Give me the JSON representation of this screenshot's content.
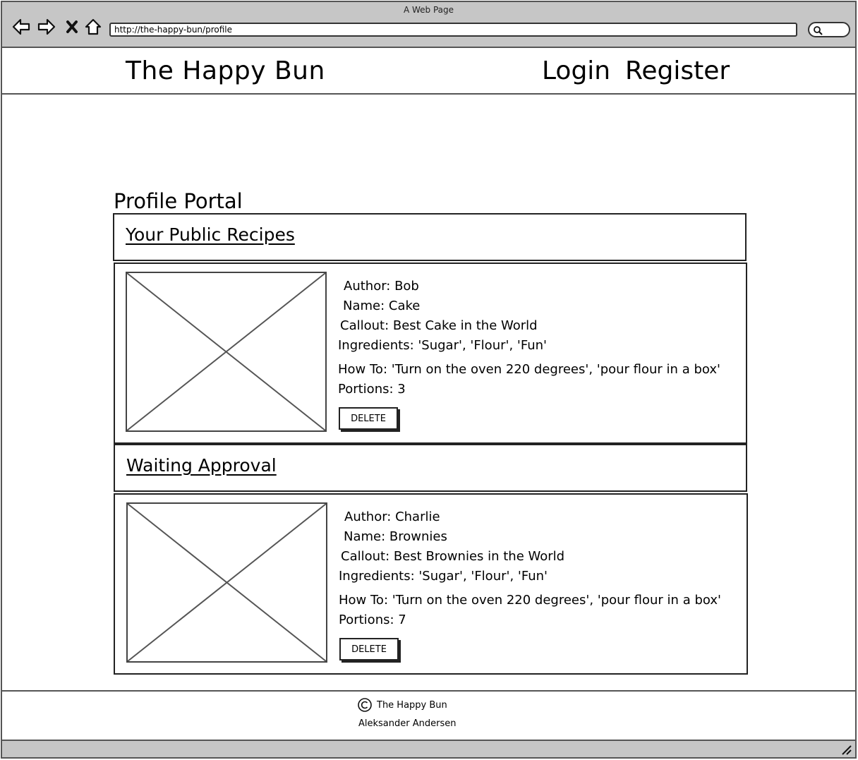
{
  "window": {
    "title": "A Web Page"
  },
  "browser": {
    "url": "http://the-happy-bun/profile",
    "icons": [
      "back-arrow-icon",
      "forward-arrow-icon",
      "close-x-icon",
      "home-icon",
      "search-icon"
    ]
  },
  "header": {
    "brand": "The Happy Bun",
    "nav": {
      "login": "Login",
      "register": "Register"
    }
  },
  "page_title": "Profile Portal",
  "sections": {
    "public": {
      "title": "Your Public Recipes",
      "recipe": {
        "author": "Author: Bob",
        "name": "Name: Cake",
        "callout": "Callout: Best Cake in the World",
        "ingredients": "Ingredients: 'Sugar', 'Flour', 'Fun'",
        "howto": "How To: 'Turn on the oven 220 degrees', 'pour flour in a box'",
        "portions": "Portions: 3",
        "delete_label": "DELETE"
      }
    },
    "waiting": {
      "title": "Waiting Approval",
      "recipe": {
        "author": "Author: Charlie",
        "name": "Name: Brownies",
        "callout": "Callout: Best Brownies in the World",
        "ingredients": "Ingredients: 'Sugar', 'Flour', 'Fun'",
        "howto": "How To: 'Turn on the oven 220 degrees', 'pour flour in a box'",
        "portions": "Portions: 7",
        "delete_label": "DELETE"
      }
    }
  },
  "footer": {
    "brand": "The Happy Bun",
    "author": "Aleksander Andersen"
  }
}
